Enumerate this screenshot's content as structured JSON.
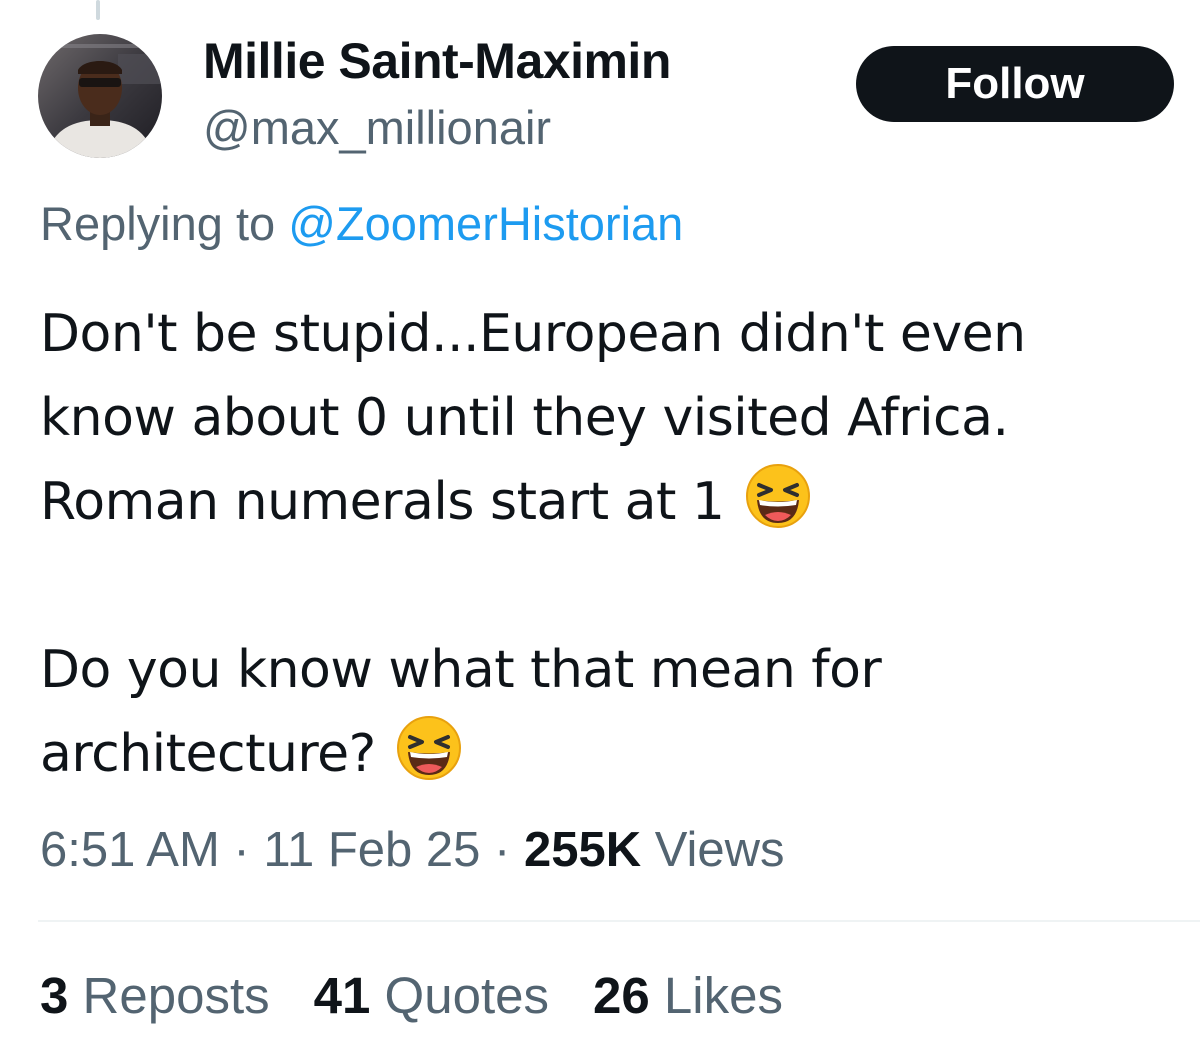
{
  "author": {
    "display_name": "Millie Saint-Maximin",
    "handle": "@max_millionair"
  },
  "follow_button": {
    "label": "Follow"
  },
  "reply_context": {
    "prefix": "Replying to",
    "mention": "@ZoomerHistorian"
  },
  "tweet": {
    "lines": [
      "Don't be stupid...European didn't even",
      "know about 0 until they visited Africa.",
      "Roman numerals start at 1",
      "Do you know what that mean for",
      "architecture?"
    ],
    "emoji": "grinning-squinting-face"
  },
  "meta": {
    "time": "6:51 AM",
    "date": "11 Feb 25",
    "views_count": "255K",
    "views_label": "Views",
    "separator": "·"
  },
  "stats": {
    "reposts_count": "3",
    "reposts_label": "Reposts",
    "quotes_count": "41",
    "quotes_label": "Quotes",
    "likes_count": "26",
    "likes_label": "Likes"
  },
  "colors": {
    "text": "#0f1419",
    "secondary": "#536471",
    "link": "#1d9bf0",
    "button_bg": "#0f1419"
  }
}
